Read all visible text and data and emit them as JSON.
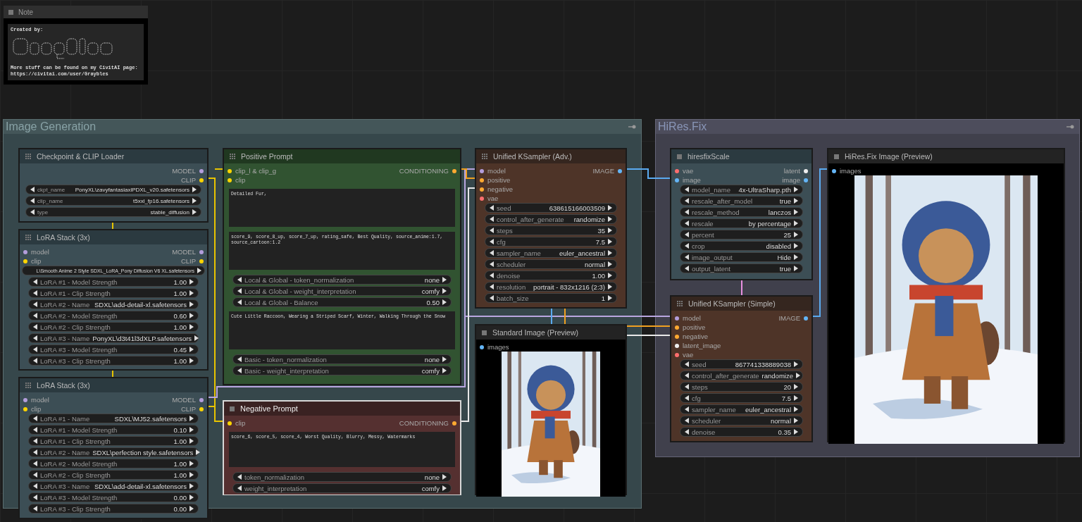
{
  "note": {
    "title": "Note",
    "lines": [
      "Created by:",
      "More stuff can be found on my CivitAI page:",
      "https://civitai.com/user/Graybles"
    ]
  },
  "groups": [
    {
      "title": "Image Generation"
    },
    {
      "title": "HiRes.Fix"
    }
  ],
  "nodes": [
    {
      "title": "Checkpoint & CLIP Loader",
      "selected": false,
      "outputs": [
        {
          "label": "MODEL",
          "color": "#b39ddb"
        },
        {
          "label": "CLIP",
          "color": "#ffd500"
        }
      ],
      "widgets": [
        {
          "kind": "combo",
          "label": "ckpt_name",
          "value": "PonyXL\\zavyfantasiaxlPDXL_v20.safetensors"
        },
        {
          "kind": "combo",
          "label": "clip_name",
          "value": "t5xxl_fp16.safetensors"
        },
        {
          "kind": "combo",
          "label": "type",
          "value": "stable_diffusion"
        }
      ]
    },
    {
      "title": "LoRA Stack (3x)",
      "selected": false,
      "inputs": [
        {
          "label": "model",
          "color": "#b39ddb"
        },
        {
          "label": "clip",
          "color": "#ffd500"
        }
      ],
      "outputs": [
        {
          "label": "MODEL",
          "color": "#b39ddb"
        },
        {
          "label": "CLIP",
          "color": "#ffd500"
        }
      ],
      "widgets": [
        {
          "kind": "overflow",
          "value": "L\\Smooth Anime 2 Style SDXL_LoRA_Pony Diffusion V6 XL.safetensors"
        },
        {
          "kind": "combo",
          "label": "LoRA #1 - Model Strength",
          "value": "1.00"
        },
        {
          "kind": "combo",
          "label": "LoRA #1 - Clip Strength",
          "value": "1.00"
        },
        {
          "kind": "combo",
          "label": "LoRA #2 - Name",
          "value": "SDXL\\add-detail-xl.safetensors"
        },
        {
          "kind": "combo",
          "label": "LoRA #2 - Model Strength",
          "value": "0.60"
        },
        {
          "kind": "combo",
          "label": "LoRA #2 - Clip Strength",
          "value": "1.00"
        },
        {
          "kind": "combo",
          "label": "LoRA #3 - Name",
          "value": "PonyXL\\d3t41l3dXLP.safetensors"
        },
        {
          "kind": "combo",
          "label": "LoRA #3 - Model Strength",
          "value": "0.45"
        },
        {
          "kind": "combo",
          "label": "LoRA #3 - Clip Strength",
          "value": "1.00"
        }
      ]
    },
    {
      "title": "LoRA Stack (3x)",
      "selected": false,
      "inputs": [
        {
          "label": "model",
          "color": "#b39ddb"
        },
        {
          "label": "clip",
          "color": "#ffd500"
        }
      ],
      "outputs": [
        {
          "label": "MODEL",
          "color": "#b39ddb"
        },
        {
          "label": "CLIP",
          "color": "#ffd500"
        }
      ],
      "widgets": [
        {
          "kind": "combo",
          "label": "LoRA #1 - Name",
          "value": "SDXL\\MJ52.safetensors"
        },
        {
          "kind": "combo",
          "label": "LoRA #1 - Model Strength",
          "value": "0.10"
        },
        {
          "kind": "combo",
          "label": "LoRA #1 - Clip Strength",
          "value": "1.00"
        },
        {
          "kind": "combo",
          "label": "LoRA #2 - Name",
          "value": "SDXL\\perfection style.safetensors"
        },
        {
          "kind": "combo",
          "label": "LoRA #2 - Model Strength",
          "value": "1.00"
        },
        {
          "kind": "combo",
          "label": "LoRA #2 - Clip Strength",
          "value": "1.00"
        },
        {
          "kind": "combo",
          "label": "LoRA #3 - Name",
          "value": "SDXL\\add-detail-xl.safetensors"
        },
        {
          "kind": "combo",
          "label": "LoRA #3 - Model Strength",
          "value": "0.00"
        },
        {
          "kind": "combo",
          "label": "LoRA #3 - Clip Strength",
          "value": "0.00"
        }
      ]
    },
    {
      "title": "Positive Prompt",
      "selected": false,
      "inputs": [
        {
          "label": "clip_l & clip_g",
          "color": "#ffd500"
        },
        {
          "label": "clip",
          "color": "#ffd500"
        }
      ],
      "outputs": [
        {
          "label": "CONDITIONING",
          "color": "#ffa931"
        }
      ],
      "widgets": [
        {
          "kind": "text",
          "value": "Detailed Fur,"
        },
        {
          "kind": "text",
          "value": "score_9, score_8_up, score_7_up, rating_safe, Best Quality, source_anime:1.7, source_cartoon:1.2"
        },
        {
          "kind": "combo",
          "label": "Local & Global - token_normalization",
          "value": "none"
        },
        {
          "kind": "combo",
          "label": "Local & Global - weight_interpretation",
          "value": "comfy"
        },
        {
          "kind": "combo",
          "label": "Local & Global - Balance",
          "value": "0.50"
        },
        {
          "kind": "text",
          "value": "Cute Little Raccoon, Wearing a Striped Scarf, Winter, Walking Through the Snow"
        },
        {
          "kind": "combo",
          "label": "Basic - token_normalization",
          "value": "none"
        },
        {
          "kind": "combo",
          "label": "Basic - weight_interpretation",
          "value": "comfy"
        }
      ]
    },
    {
      "title": "Negative Prompt",
      "selected": true,
      "inputs": [
        {
          "label": "clip",
          "color": "#ffd500"
        }
      ],
      "outputs": [
        {
          "label": "CONDITIONING",
          "color": "#ffa931"
        }
      ],
      "widgets": [
        {
          "kind": "text",
          "value": "score_6, score_5, score_4, Worst Quality, Blurry, Messy, Watermarks"
        },
        {
          "kind": "combo",
          "label": "token_normalization",
          "value": "none"
        },
        {
          "kind": "combo",
          "label": "weight_interpretation",
          "value": "comfy"
        }
      ]
    },
    {
      "title": "Unified KSampler (Adv.)",
      "selected": false,
      "inputs": [
        {
          "label": "model",
          "color": "#b39ddb"
        },
        {
          "label": "positive",
          "color": "#ffa931"
        },
        {
          "label": "negative",
          "color": "#ffa931"
        },
        {
          "label": "vae",
          "color": "#ff6e6e"
        }
      ],
      "outputs": [
        {
          "label": "IMAGE",
          "color": "#64b5f6"
        }
      ],
      "widgets": [
        {
          "kind": "combo",
          "label": "seed",
          "value": "638615166003509"
        },
        {
          "kind": "combo",
          "label": "control_after_generate",
          "value": "randomize"
        },
        {
          "kind": "combo",
          "label": "steps",
          "value": "35"
        },
        {
          "kind": "combo",
          "label": "cfg",
          "value": "7.5"
        },
        {
          "kind": "combo",
          "label": "sampler_name",
          "value": "euler_ancestral"
        },
        {
          "kind": "combo",
          "label": "scheduler",
          "value": "normal"
        },
        {
          "kind": "combo",
          "label": "denoise",
          "value": "1.00"
        },
        {
          "kind": "combo",
          "label": "resolution",
          "value": "portrait - 832x1216 (2:3)"
        },
        {
          "kind": "combo",
          "label": "batch_size",
          "value": "1"
        }
      ]
    },
    {
      "title": "Standard Image (Preview)",
      "selected": false,
      "inputs": [
        {
          "label": "images",
          "color": "#64b5f6"
        }
      ],
      "widgets": [
        {
          "kind": "picture"
        }
      ]
    },
    {
      "title": "hiresfixScale",
      "selected": false,
      "inputs": [
        {
          "label": "vae",
          "color": "#ff6e6e"
        },
        {
          "label": "image",
          "color": "#64b5f6"
        }
      ],
      "outputs": [
        {
          "label": "latent",
          "color": "#eeeeee"
        },
        {
          "label": "image",
          "color": "#64b5f6"
        }
      ],
      "widgets": [
        {
          "kind": "combo",
          "label": "model_name",
          "value": "4x-UltraSharp.pth"
        },
        {
          "kind": "combo",
          "label": "rescale_after_model",
          "value": "true"
        },
        {
          "kind": "combo",
          "label": "rescale_method",
          "value": "lanczos"
        },
        {
          "kind": "combo",
          "label": "rescale",
          "value": "by percentage"
        },
        {
          "kind": "combo",
          "label": "percent",
          "value": "25"
        },
        {
          "kind": "combo",
          "label": "crop",
          "value": "disabled"
        },
        {
          "kind": "combo",
          "label": "image_output",
          "value": "Hide"
        },
        {
          "kind": "combo",
          "label": "output_latent",
          "value": "true"
        }
      ]
    },
    {
      "title": "Unified KSampler (Simple)",
      "selected": false,
      "inputs": [
        {
          "label": "model",
          "color": "#b39ddb"
        },
        {
          "label": "positive",
          "color": "#ffa931"
        },
        {
          "label": "negative",
          "color": "#ffa931"
        },
        {
          "label": "latent_image",
          "color": "#eeeeee"
        },
        {
          "label": "vae",
          "color": "#ff6e6e"
        }
      ],
      "outputs": [
        {
          "label": "IMAGE",
          "color": "#64b5f6"
        }
      ],
      "widgets": [
        {
          "kind": "combo",
          "label": "seed",
          "value": "867741338889038"
        },
        {
          "kind": "combo",
          "label": "control_after_generate",
          "value": "randomize"
        },
        {
          "kind": "combo",
          "label": "steps",
          "value": "20"
        },
        {
          "kind": "combo",
          "label": "cfg",
          "value": "7.5"
        },
        {
          "kind": "combo",
          "label": "sampler_name",
          "value": "euler_ancestral"
        },
        {
          "kind": "combo",
          "label": "scheduler",
          "value": "normal"
        },
        {
          "kind": "combo",
          "label": "denoise",
          "value": "0.35"
        }
      ]
    },
    {
      "title": "HiRes.Fix Image (Preview)",
      "selected": false,
      "inputs": [
        {
          "label": "images",
          "color": "#64b5f6"
        }
      ],
      "widgets": [
        {
          "kind": "picture"
        }
      ]
    }
  ]
}
